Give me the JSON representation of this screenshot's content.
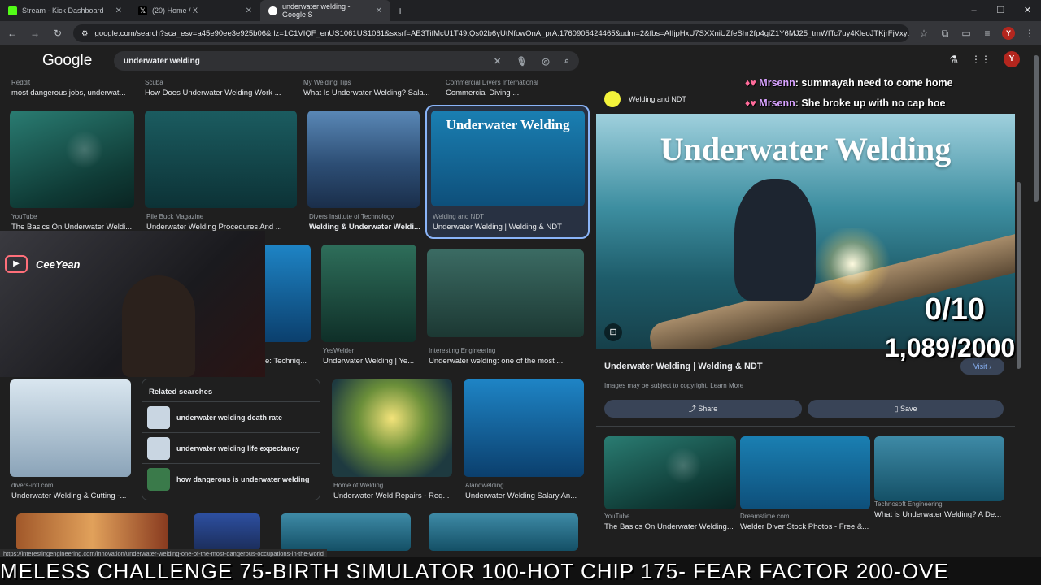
{
  "tabs": [
    {
      "title": "Stream - Kick Dashboard",
      "color": "#53fc18"
    },
    {
      "title": "(20) Home / X",
      "color": "#ffffff"
    },
    {
      "title": "underwater welding - Google S",
      "color": "#4285f4"
    }
  ],
  "url": "google.com/search?sca_esv=a45e90ee3e925b06&rlz=1C1VIQF_enUS1061US1061&sxsrf=AE3TifMcU1T49tQs02b6yUtNfowOnA_prA:1760905424465&udm=2&fbs=AIIjpHxU7SXXniUZfeShr2fp4giZ1Y6MJ25_tmWITc7uy4KleoJTKjrFjVxydQWql2...",
  "google": {
    "logo": "Google",
    "query": "underwater welding"
  },
  "grid": [
    {
      "source": "Reddit",
      "title": "most dangerous jobs, underwat..."
    },
    {
      "source": "Scuba",
      "title": "How Does Underwater Welding Work ..."
    },
    {
      "source": "My Welding Tips",
      "title": "What Is Underwater Welding? Sala..."
    },
    {
      "source": "Commercial Divers International",
      "title": "Commercial Diving ..."
    },
    {
      "source": "YouTube",
      "title": "The Basics On Underwater Weldi..."
    },
    {
      "source": "Pile Buck Magazine",
      "title": "Underwater Welding Procedures And ..."
    },
    {
      "source": "Divers Institute of Technology",
      "title": "Welding & Underwater Weldi..."
    },
    {
      "source": "Welding and NDT",
      "title": "Underwater Welding | Welding & NDT",
      "img_text": "Underwater Welding"
    },
    {
      "source": "",
      "title": "e: Techniq..."
    },
    {
      "source": "YesWelder",
      "title": "Underwater Welding | Ye..."
    },
    {
      "source": "Interesting Engineering",
      "title": "Underwater welding: one of the most ..."
    },
    {
      "source": "divers-intl.com",
      "title": "Underwater Welding & Cutting -..."
    },
    {
      "source": "Home of Welding",
      "title": "Underwater Weld Repairs - Req..."
    },
    {
      "source": "Alandwelding",
      "title": "Underwater Welding Salary An..."
    }
  ],
  "related": {
    "heading": "Related searches",
    "items": [
      "underwater welding death rate",
      "underwater welding life expectancy",
      "how dangerous is underwater welding"
    ]
  },
  "panel": {
    "source": "Welding and NDT",
    "image_title": "Underwater Welding",
    "title": "Underwater Welding | Welding & NDT",
    "copyright": "Images may be subject to copyright. Learn More",
    "visit": "Visit",
    "share": "Share",
    "save": "Save",
    "related": [
      {
        "source": "YouTube",
        "title": "The Basics On Underwater Welding..."
      },
      {
        "source": "Dreamstime.com",
        "title": "Welder Diver Stock Photos - Free &..."
      },
      {
        "source": "Technosoft Engineering",
        "title": "What is Underwater Welding? A De..."
      }
    ]
  },
  "overlay": {
    "counter1": "0/10",
    "counter2": "1,089/2000",
    "streamer": "CeeYean",
    "chat": [
      {
        "user": "Mrsenn",
        "msg": "summayah need to come home"
      },
      {
        "user": "Mrsenn",
        "msg": "She broke up with no cap hoe"
      }
    ],
    "ticker": "MELESS CHALLENGE  75-BIRTH SIMULATOR 100-HOT CHIP 175- FEAR FACTOR 200-OVE"
  },
  "status_url": "https://interestingengineering.com/innovation/underwater-welding-one-of-the-most-dangerous-occupations-in-the-world"
}
